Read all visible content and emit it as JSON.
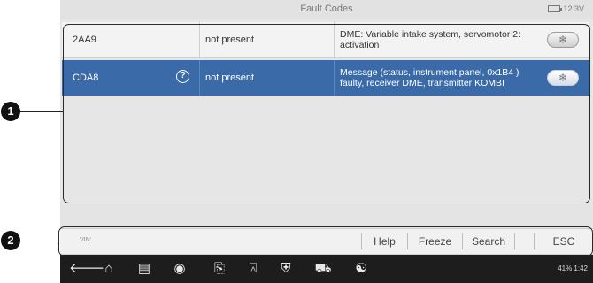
{
  "titlebar": {
    "title": "Fault Codes",
    "battery": "12.3V"
  },
  "faults": [
    {
      "code": "2AA9",
      "status": "not present",
      "description": "DME: Variable intake system, servomotor 2: activation",
      "has_help": false
    },
    {
      "code": "CDA8",
      "status": "not present",
      "description": "Message (status, instrument panel, 0x1B4 ) faulty, receiver DME, transmitter KOMBI",
      "has_help": true
    }
  ],
  "toolbar": {
    "vin_label": "VIN:",
    "help": "Help",
    "freeze": "Freeze",
    "search": "Search",
    "esc": "ESC"
  },
  "navbar": {
    "status": "41% 1:42"
  },
  "callouts": {
    "one": "1",
    "two": "2"
  }
}
